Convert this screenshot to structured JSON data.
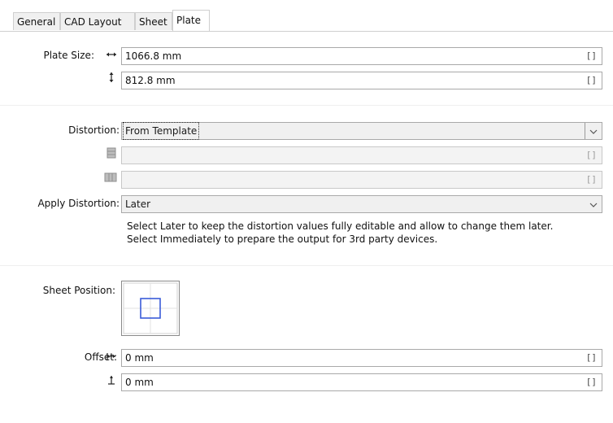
{
  "tabs": [
    {
      "label": "General"
    },
    {
      "label": "CAD Layout"
    },
    {
      "label": "Sheet"
    },
    {
      "label": "Plate",
      "active": true
    }
  ],
  "plate_size": {
    "label": "Plate Size:",
    "width": {
      "value": "1066.8 mm",
      "icon": "horizontal-arrows-icon"
    },
    "height": {
      "value": "812.8 mm",
      "icon": "vertical-arrows-icon"
    },
    "suffix": "[]"
  },
  "distortion": {
    "label": "Distortion:",
    "selected": "From Template",
    "horizontal_icon": "horizontal-distortion-icon",
    "vertical_icon": "vertical-distortion-icon",
    "suffix": "[]"
  },
  "apply_distortion": {
    "label": "Apply Distortion:",
    "selected": "Later",
    "help_line1": "Select Later to keep the distortion values fully editable and allow to change them later.",
    "help_line2": "Select Immediately to prepare the output for 3rd party devices."
  },
  "sheet_position": {
    "label": "Sheet Position:"
  },
  "offset": {
    "label": "Offset:",
    "x": {
      "value": "0 mm",
      "icon": "horizontal-offset-icon"
    },
    "y": {
      "value": "0 mm",
      "icon": "vertical-offset-icon"
    },
    "suffix": "[]"
  },
  "colors": {
    "accent_square": "#3a5bd9",
    "border": "#a9a9a9"
  }
}
